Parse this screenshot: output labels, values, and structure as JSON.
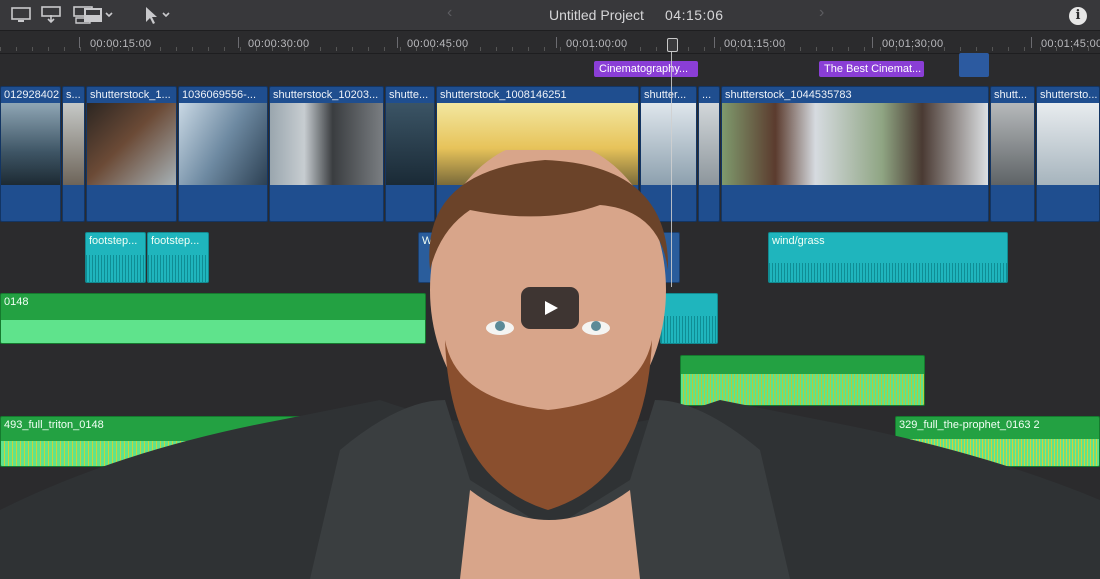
{
  "toolbar": {
    "project_title": "Untitled Project",
    "duration": "04:15:06",
    "icons": [
      "monitor-icon",
      "import-icon",
      "export-icon",
      "display-dropdown-icon",
      "chevron-down-icon",
      "pointer-tool-icon",
      "chevron-down-icon"
    ]
  },
  "ruler": {
    "labels": [
      "00:00:15:00",
      "00:00:30:00",
      "00:00:45:00",
      "00:01:00:00",
      "00:01:15:00",
      "00:01:30:00",
      "00:01:45:00"
    ]
  },
  "markers": [
    {
      "label": "Cinematography..."
    },
    {
      "label": "The Best Cinemat..."
    }
  ],
  "video_clips": [
    {
      "label": "012928402"
    },
    {
      "label": "s..."
    },
    {
      "label": "shutterstock_1..."
    },
    {
      "label": "1036069556-..."
    },
    {
      "label": "shutterstock_10203..."
    },
    {
      "label": "shutte..."
    },
    {
      "label": "shutterstock_1008146251"
    },
    {
      "label": "shutter..."
    },
    {
      "label": "..."
    },
    {
      "label": "shutterstock_1044535783"
    },
    {
      "label": "shutt..."
    },
    {
      "label": "shuttersto..."
    }
  ],
  "audio_clips": [
    {
      "label": "footstep..."
    },
    {
      "label": "footstep..."
    },
    {
      "label": "Wi..."
    },
    {
      "label": "wind/grass"
    },
    {
      "label": "0148"
    },
    {
      "label": "493_full_triton_0148"
    },
    {
      "label": "329_full_the-prophet_0163 2"
    }
  ],
  "colors": {
    "video_clip": "#1f4e8f",
    "sfx_clip": "#1fb5bd",
    "music_clip": "#23a142",
    "marker": "#8a3ed6"
  },
  "overlay": {
    "play_button": "play-icon"
  }
}
